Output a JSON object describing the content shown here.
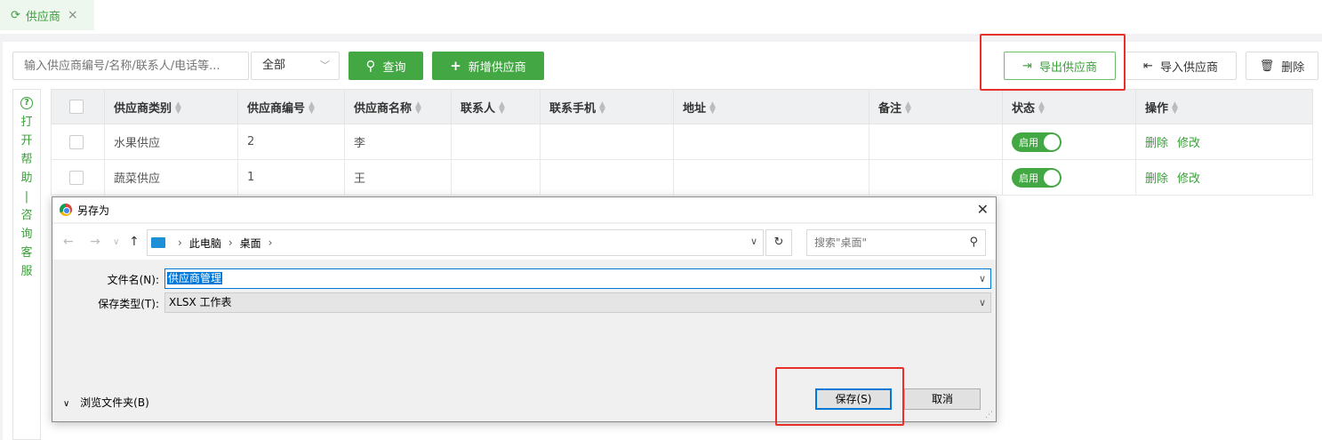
{
  "tab": {
    "label": "供应商",
    "close": "×",
    "refresh_icon": "⟳"
  },
  "toolbar": {
    "search_placeholder": "输入供应商编号/名称/联系人/电话等...",
    "select_value": "全部",
    "query_label": "查询",
    "add_label": "新增供应商",
    "export_label": "导出供应商",
    "import_label": "导入供应商",
    "delete_label": "删除"
  },
  "help": {
    "text": "打开帮助|咨询客服"
  },
  "table": {
    "columns": [
      "供应商类别",
      "供应商编号",
      "供应商名称",
      "联系人",
      "联系手机",
      "地址",
      "备注",
      "状态",
      "操作"
    ],
    "rows": [
      {
        "category": "水果供应",
        "code": "2",
        "name": "李",
        "contact": "",
        "phone": "",
        "address": "",
        "note": "",
        "status": "启用",
        "ops": [
          "删除",
          "修改"
        ]
      },
      {
        "category": "蔬菜供应",
        "code": "1",
        "name": "王",
        "contact": "",
        "phone": "",
        "address": "",
        "note": "",
        "status": "启用",
        "ops": [
          "删除",
          "修改"
        ]
      }
    ]
  },
  "dialog": {
    "title": "另存为",
    "breadcrumb": [
      "此电脑",
      "桌面"
    ],
    "search_placeholder": "搜索\"桌面\"",
    "filename_label": "文件名(N):",
    "filename_value": "供应商管理",
    "filetype_label": "保存类型(T):",
    "filetype_value": "XLSX 工作表",
    "browse_label": "浏览文件夹(B)",
    "save_label": "保存(S)",
    "cancel_label": "取消"
  },
  "colors": {
    "accent": "#43a843",
    "highlight": "#e8302a",
    "selection": "#0078d7"
  }
}
